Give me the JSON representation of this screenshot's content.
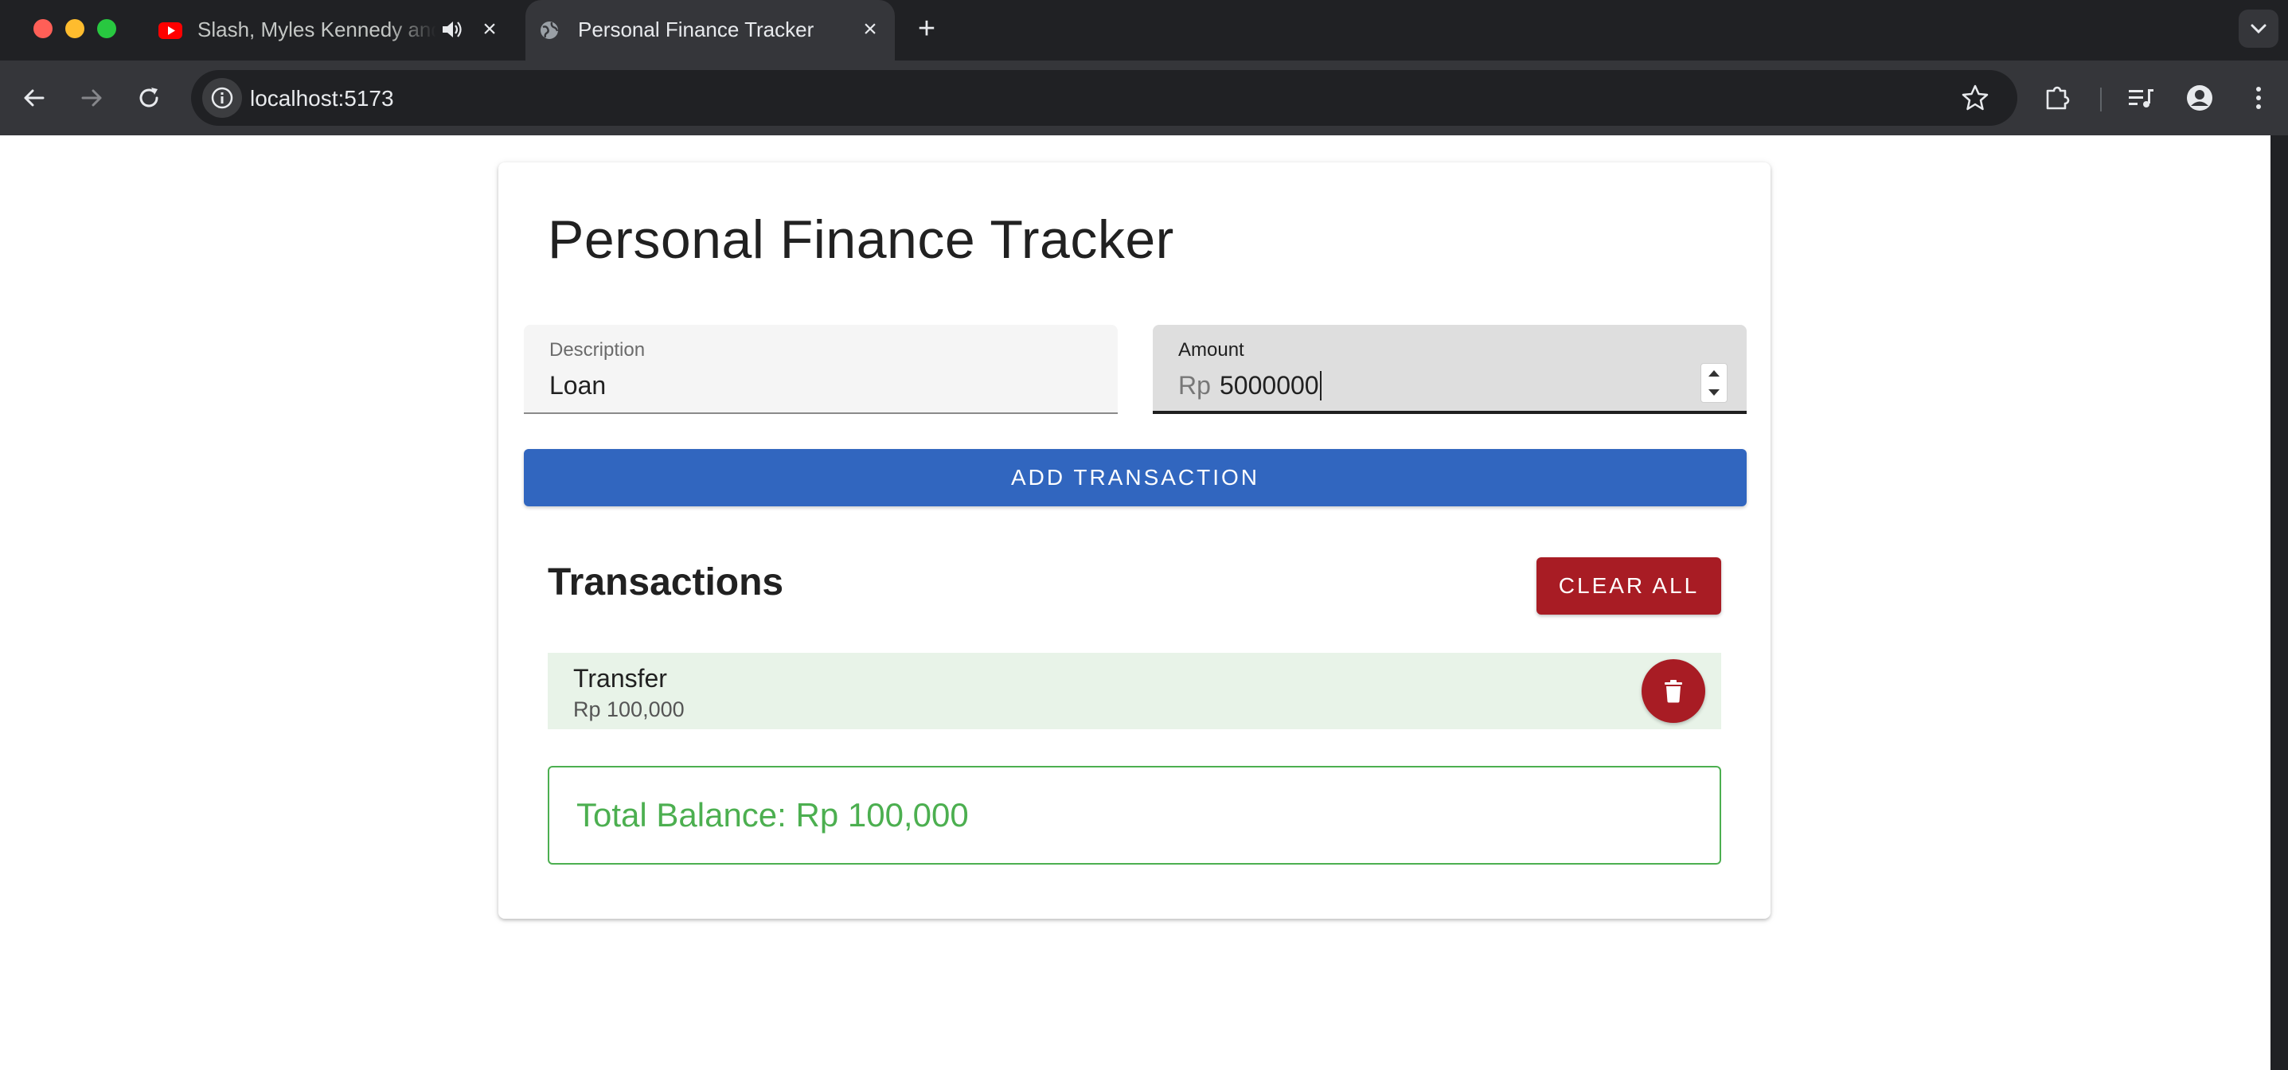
{
  "browser": {
    "tabs": [
      {
        "title": "Slash, Myles Kennedy and",
        "favicon": "youtube-icon",
        "audio": true,
        "active": false
      },
      {
        "title": "Personal Finance Tracker",
        "favicon": "globe-icon",
        "active": true
      }
    ],
    "url": "localhost:5173"
  },
  "app": {
    "title": "Personal Finance Tracker",
    "form": {
      "description": {
        "label": "Description",
        "value": "Loan"
      },
      "amount": {
        "label": "Amount",
        "prefix": "Rp",
        "value": "5000000"
      },
      "add_button": "ADD TRANSACTION"
    },
    "transactions": {
      "heading": "Transactions",
      "clear_button": "CLEAR ALL",
      "items": [
        {
          "name": "Transfer",
          "amount": "Rp 100,000"
        }
      ]
    },
    "balance": "Total Balance: Rp 100,000"
  },
  "colors": {
    "primary": "#3166bf",
    "danger": "#a81c24",
    "success": "#4caf50",
    "transaction_bg": "#e8f3e8"
  }
}
